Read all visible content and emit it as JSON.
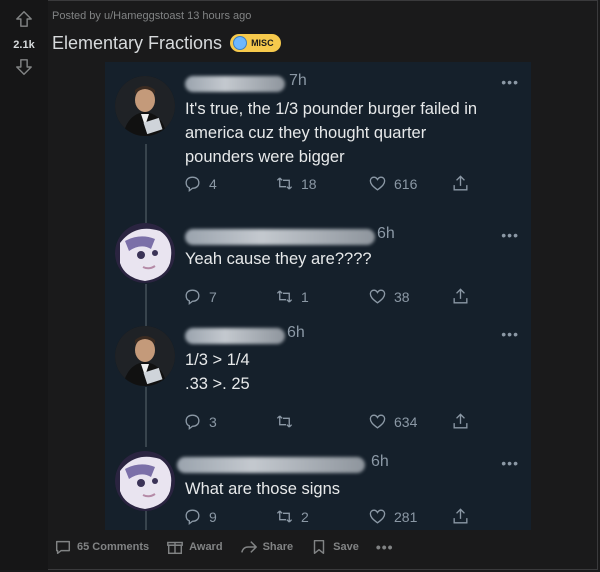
{
  "post": {
    "score": "2.1k",
    "meta": "Posted by u/Hameggstoast 13 hours ago",
    "title": "Elementary Fractions",
    "flair": "MISC"
  },
  "tweets": [
    {
      "time": "7h",
      "text_lines": [
        "It's true, the 1/3 pounder burger failed in",
        "america cuz they thought quarter",
        "pounders were bigger"
      ],
      "replies": "4",
      "retweets": "18",
      "likes": "616"
    },
    {
      "time": "6h",
      "text_lines": [
        "Yeah cause they are????"
      ],
      "replies": "7",
      "retweets": "1",
      "likes": "38"
    },
    {
      "time": "6h",
      "text_lines": [
        "1/3 > 1/4",
        ".33 >. 25"
      ],
      "replies": "3",
      "retweets": "",
      "likes": "634"
    },
    {
      "time": "6h",
      "text_lines": [
        "What are those signs"
      ],
      "replies": "9",
      "retweets": "2",
      "likes": "281"
    }
  ],
  "footer": {
    "comments": "65 Comments",
    "award": "Award",
    "share": "Share",
    "save": "Save",
    "more": "•••"
  },
  "icons": {
    "upvote": "upvote-arrow-icon",
    "downvote": "downvote-arrow-icon",
    "reply": "reply-bubble-icon",
    "retweet": "retweet-icon",
    "like": "heart-icon",
    "share": "share-upload-icon"
  },
  "colors": {
    "page_bg": "#1a1a1b",
    "tweet_bg": "#15202b",
    "flair": "#f6c94c",
    "muted": "#818384"
  }
}
